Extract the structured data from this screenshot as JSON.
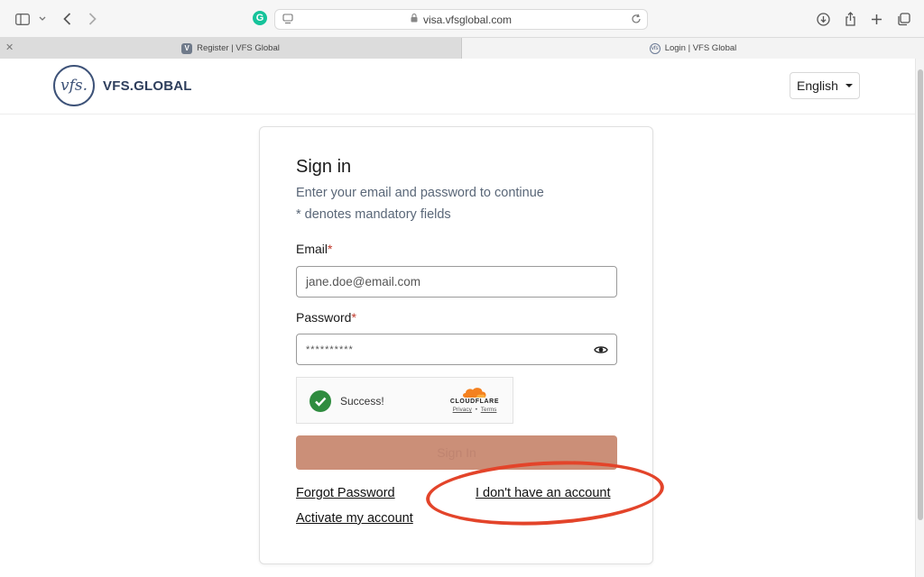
{
  "browser": {
    "url": "visa.vfsglobal.com",
    "tabs": [
      {
        "label": "Register | VFS Global",
        "favicon": "V"
      },
      {
        "label": "Login | VFS Global",
        "favicon": "vfs"
      }
    ],
    "grammarly_letter": "G"
  },
  "header": {
    "logo_mark": "vfs.",
    "logo_text": "VFS.GLOBAL",
    "language": "English"
  },
  "signin": {
    "title": "Sign in",
    "subtitle": "Enter your email and password to continue",
    "mandatory_note": "* denotes mandatory fields",
    "email_label": "Email",
    "email_placeholder": "jane.doe@email.com",
    "password_label": "Password",
    "password_value": "**********",
    "required_mark": "*",
    "captcha": {
      "status": "Success!",
      "brand": "CLOUDFLARE",
      "privacy": "Privacy",
      "separator": "•",
      "terms": "Terms"
    },
    "submit_label": "Sign In",
    "forgot_password": "Forgot Password",
    "no_account": "I don't have an account",
    "activate": "Activate my account"
  },
  "colors": {
    "brand": "#2e3e5c",
    "button": "#cb8f78",
    "success": "#2f8c3f",
    "annotation": "#e3442a"
  },
  "icons": [
    "sidebar-icon",
    "chevron-down-icon",
    "back-icon",
    "forward-icon",
    "lock-icon",
    "reload-icon",
    "download-icon",
    "share-icon",
    "new-tab-icon",
    "tabs-overview-icon",
    "eye-icon",
    "check-icon",
    "cloud-icon",
    "caret-down-icon"
  ]
}
